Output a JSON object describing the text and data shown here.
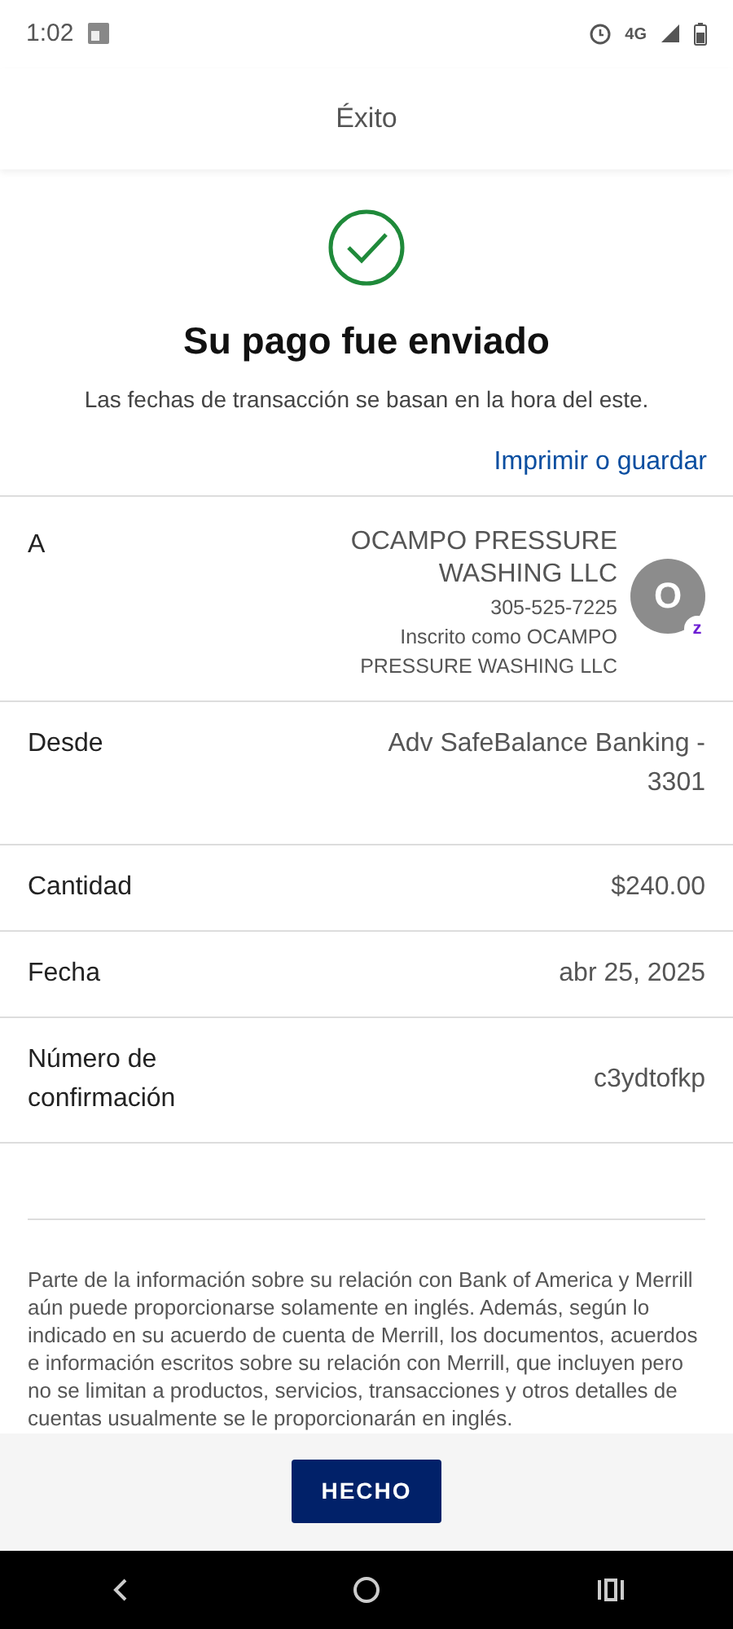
{
  "status_bar": {
    "time": "1:02",
    "network": "4G"
  },
  "header": {
    "title": "Éxito"
  },
  "result": {
    "title": "Su pago fue enviado",
    "subtitle": "Las fechas de transacción se basan en la hora del este.",
    "print_link": "Imprimir o guardar"
  },
  "recipient": {
    "label": "A",
    "name": "OCAMPO PRESSURE WASHING LLC",
    "phone": "305-525-7225",
    "enrolled": "Inscrito como OCAMPO PRESSURE WASHING LLC",
    "avatar": {
      "initial": "O",
      "badge": "z"
    }
  },
  "details": [
    {
      "label": "Desde",
      "value": "Adv SafeBalance Banking - 3301"
    },
    {
      "label": "Cantidad",
      "value": "$240.00"
    },
    {
      "label": "Fecha",
      "value": "abr 25, 2025"
    },
    {
      "label": "Número de confirmación",
      "value": "c3ydtofkp"
    }
  ],
  "disclaimer": "Parte de la información sobre su relación con Bank of America y Merrill aún puede proporcionarse solamente en inglés. Además, según lo indicado en su acuerdo de cuenta de Merrill, los documentos, acuerdos e información escritos sobre su relación con Merrill, que incluyen pero no se limitan a productos, servicios, transacciones y otros detalles de cuentas usualmente se le proporcionarán en inglés.",
  "done_button": "HECHO"
}
